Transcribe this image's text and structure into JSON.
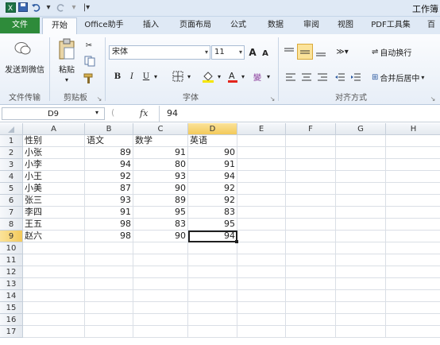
{
  "window": {
    "title": "工作簿"
  },
  "qat": {
    "save_icon": "save-icon",
    "undo_icon": "undo-icon",
    "redo_icon": "redo-icon"
  },
  "tabs": [
    "文件",
    "开始",
    "Office助手",
    "插入",
    "页面布局",
    "公式",
    "数据",
    "审阅",
    "视图",
    "PDF工具集",
    "百"
  ],
  "ribbon": {
    "send_wechat": "发送到微信",
    "file_transfer": "文件传输",
    "paste": "粘贴",
    "clipboard": "剪贴板",
    "font_name": "宋体",
    "font_size": "11",
    "font_group": "字体",
    "align_group": "对齐方式",
    "wrap_text": "自动换行",
    "merge_center": "合并后居中",
    "bold": "B",
    "italic": "I",
    "underline": "U",
    "grow_font": "A",
    "shrink_font": "A",
    "wen": "變"
  },
  "formula_bar": {
    "name_box": "D9",
    "fx": "fx",
    "value": "94"
  },
  "columns": [
    "A",
    "B",
    "C",
    "D",
    "E",
    "F",
    "G",
    "H"
  ],
  "rows": [
    "1",
    "2",
    "3",
    "4",
    "5",
    "6",
    "7",
    "8",
    "9",
    "10",
    "11",
    "12",
    "13",
    "14",
    "15",
    "16",
    "17"
  ],
  "table": {
    "headers": [
      "性别",
      "语文",
      "数学",
      "英语"
    ],
    "data": [
      [
        "小张",
        "89",
        "91",
        "90"
      ],
      [
        "小李",
        "94",
        "80",
        "91"
      ],
      [
        "小王",
        "92",
        "93",
        "94"
      ],
      [
        "小美",
        "87",
        "90",
        "92"
      ],
      [
        "张三",
        "93",
        "89",
        "92"
      ],
      [
        "李四",
        "91",
        "95",
        "83"
      ],
      [
        "王五",
        "98",
        "83",
        "95"
      ],
      [
        "赵六",
        "98",
        "90",
        "94"
      ]
    ]
  },
  "colors": {
    "file_tab": "#2e8b3a",
    "selection_header": "#f3c95a"
  }
}
